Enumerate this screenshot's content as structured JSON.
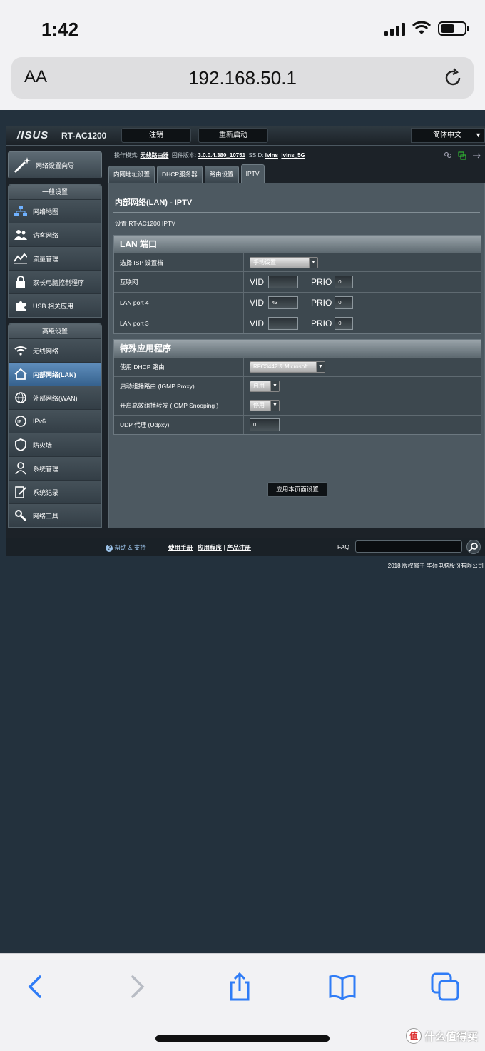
{
  "status_bar": {
    "time": "1:42"
  },
  "browser": {
    "text_size": "AA",
    "url": "192.168.50.1"
  },
  "router": {
    "brand": "/ISUS",
    "model": "RT-AC1200",
    "logout": "注销",
    "reboot": "重新启动",
    "language": "简体中文",
    "info": {
      "mode_label": "操作模式:",
      "mode_value": "无线路由器",
      "fw_label": "固件版本:",
      "fw_value": "3.0.0.4.380_10751",
      "ssid_label": "SSID:",
      "ssid1": "lvins",
      "ssid2": "lvins_5G"
    },
    "sidebar": {
      "wizard": "网络设置向导",
      "general_title": "一般设置",
      "general": [
        "网络地图",
        "访客网络",
        "流量管理",
        "家长电脑控制程序",
        "USB 相关应用"
      ],
      "advanced_title": "高级设置",
      "advanced": [
        "无线网络",
        "内部网络(LAN)",
        "外部网络(WAN)",
        "IPv6",
        "防火墙",
        "系统管理",
        "系统记录",
        "网络工具"
      ]
    },
    "tabs": [
      "内网地址设置",
      "DHCP服务器",
      "路由设置",
      "IPTV"
    ],
    "content": {
      "title": "内部网络(LAN) - IPTV",
      "desc": "设置 RT-AC1200 IPTV",
      "lan_section": "LAN 端口",
      "isp_label": "选择 ISP 设置档",
      "isp_value": "手动设置",
      "vid": "VID",
      "prio": "PRIO",
      "ports": [
        {
          "label": "互联网",
          "vid": "",
          "prio": "0"
        },
        {
          "label": "LAN port 4",
          "vid": "43",
          "prio": "0"
        },
        {
          "label": "LAN port 3",
          "vid": "",
          "prio": "0"
        }
      ],
      "special_section": "特殊应用程序",
      "dhcp_label": "使用 DHCP 路由",
      "dhcp_value": "RFC3442 & Microsoft",
      "igmp_proxy_label": "启动组播路由 (IGMP Proxy)",
      "igmp_proxy_value": "启用",
      "igmp_snoop_label": "开启高效组播转发 (IGMP Snooping )",
      "igmp_snoop_value": "停用",
      "udpxy_label": "UDP 代理 (Udpxy)",
      "udpxy_value": "0",
      "apply": "应用本页面设置"
    },
    "footer": {
      "help": "帮助 & 支持",
      "manual": "使用手册",
      "apps": "应用程序",
      "register": "产品注册",
      "faq": "FAQ",
      "copyright": "2018 版权属于 华硕电脑股份有限公司"
    }
  },
  "watermark": "什么值得买",
  "colors": {
    "accent": "#2f7cf6",
    "active_menu": "#4a79a8"
  }
}
